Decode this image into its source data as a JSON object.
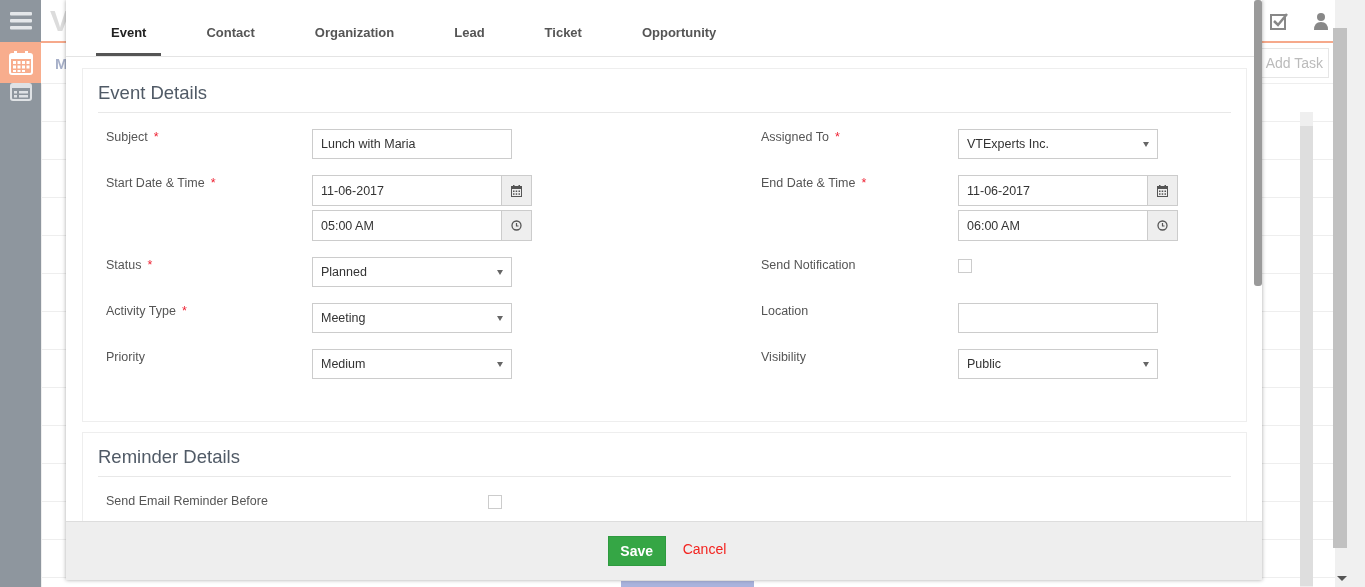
{
  "sidebar": {
    "items": [
      {
        "kind": "menu",
        "selected": false
      },
      {
        "kind": "calendar",
        "selected": true
      },
      {
        "kind": "list",
        "selected": false
      }
    ]
  },
  "background": {
    "logo": "V",
    "view_tab": "M",
    "add_task": "Add Task"
  },
  "tabs": [
    {
      "label": "Event",
      "selected": true
    },
    {
      "label": "Contact",
      "selected": false
    },
    {
      "label": "Organization",
      "selected": false
    },
    {
      "label": "Lead",
      "selected": false
    },
    {
      "label": "Ticket",
      "selected": false
    },
    {
      "label": "Opportunity",
      "selected": false
    }
  ],
  "event_details": {
    "title": "Event Details",
    "rows": [
      {
        "left": {
          "label": "Subject",
          "required_mark": "*",
          "kind": "text",
          "value": "Lunch with Maria"
        },
        "right": {
          "label": "Assigned To",
          "required_mark": "*",
          "kind": "select",
          "value": "VTExperts Inc."
        }
      },
      {
        "left": {
          "label": "Start Date & Time",
          "required_mark": "*",
          "kind": "datetime",
          "date": "11-06-2017",
          "time": "05:00 AM"
        },
        "right": {
          "label": "End Date & Time",
          "required_mark": "*",
          "kind": "datetime",
          "date": "11-06-2017",
          "time": "06:00 AM"
        }
      },
      {
        "left": {
          "label": "Status",
          "required_mark": "*",
          "kind": "select",
          "value": "Planned"
        },
        "right": {
          "label": "Send Notification",
          "kind": "checkbox",
          "checked": false
        }
      },
      {
        "left": {
          "label": "Activity Type",
          "required_mark": "*",
          "kind": "select",
          "value": "Meeting"
        },
        "right": {
          "label": "Location",
          "kind": "text"
        }
      },
      {
        "left": {
          "label": "Priority",
          "kind": "select",
          "value": "Medium"
        },
        "right": {
          "label": "Visibility",
          "kind": "select",
          "value": "Public"
        }
      }
    ]
  },
  "reminder_details": {
    "title": "Reminder Details",
    "fields": [
      {
        "label": "Send Email Reminder Before",
        "kind": "checkbox",
        "checked": false
      }
    ]
  },
  "footer": {
    "save": "Save",
    "cancel": "Cancel"
  }
}
